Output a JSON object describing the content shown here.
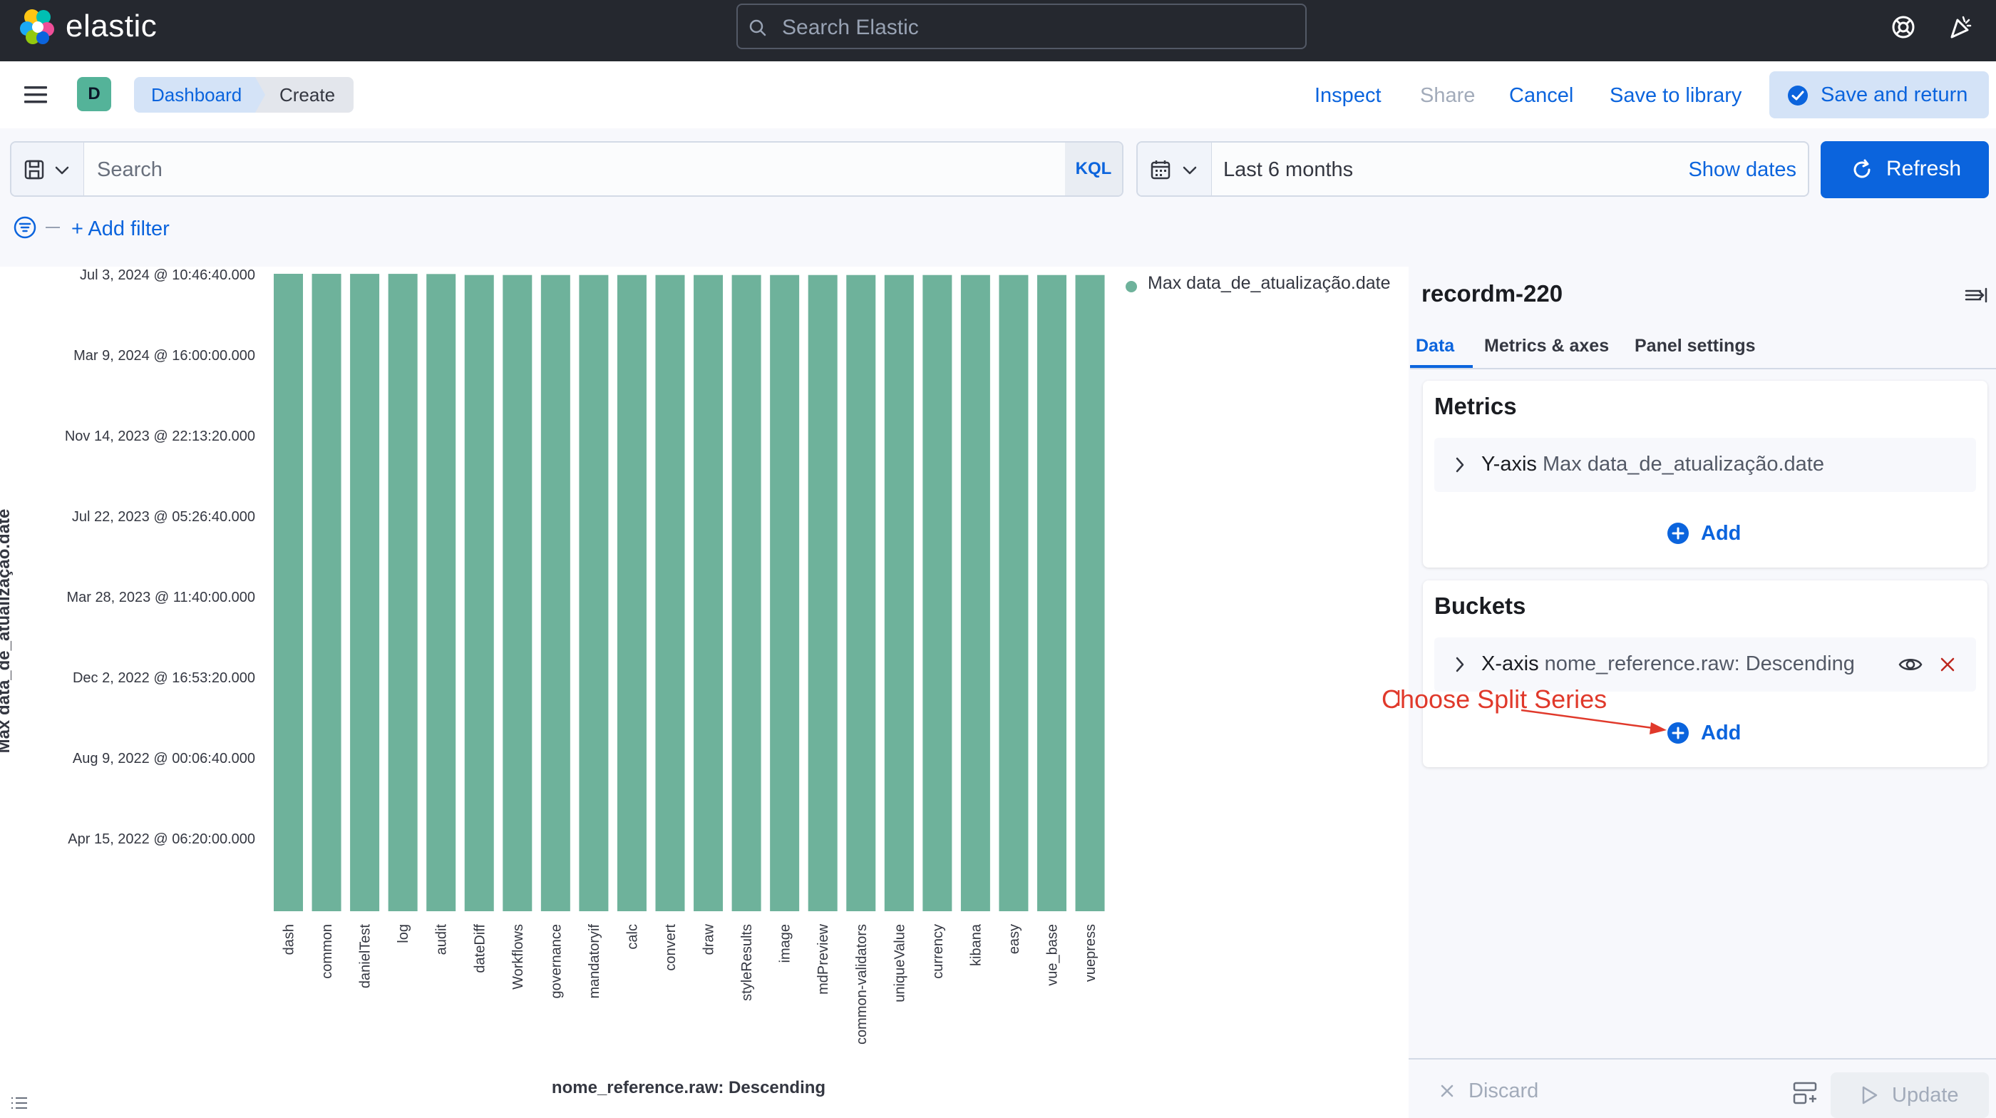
{
  "header": {
    "app_name": "elastic",
    "search_placeholder": "Search Elastic",
    "icons": [
      "elastic-logo",
      "help-icon",
      "newsfeed-icon"
    ]
  },
  "nav": {
    "avatar_letter": "D",
    "breadcrumbs": [
      "Dashboard",
      "Create"
    ],
    "links": {
      "inspect": "Inspect",
      "share": "Share",
      "cancel": "Cancel",
      "save_to_library": "Save to library",
      "save_and_return": "Save and return"
    }
  },
  "query": {
    "search_placeholder": "Search",
    "language": "KQL",
    "time_range": "Last 6 months",
    "show_dates": "Show dates",
    "refresh": "Refresh",
    "add_filter": "+ Add filter"
  },
  "chart_data": {
    "type": "bar",
    "ylabel": "Max data_de_atualização.date",
    "xlabel": "nome_reference.raw: Descending",
    "legend": [
      "Max data_de_atualização.date"
    ],
    "legend_position": "top-right",
    "color": "#6eb29b",
    "y_ticks": [
      "Jul 3, 2024 @ 10:46:40.000",
      "Mar 9, 2024 @ 16:00:00.000",
      "Nov 14, 2023 @ 22:13:20.000",
      "Jul 22, 2023 @ 05:26:40.000",
      "Mar 28, 2023 @ 11:40:00.000",
      "Dec 2, 2022 @ 16:53:20.000",
      "Aug 9, 2022 @ 00:06:40.000",
      "Apr 15, 2022 @ 06:20:00.000"
    ],
    "categories": [
      "dash",
      "common",
      "danielTest",
      "log",
      "audit",
      "dateDiff",
      "Workflows",
      "governance",
      "mandatoryif",
      "calc",
      "convert",
      "draw",
      "styleResults",
      "image",
      "mdPreview",
      "common-validators",
      "uniqueValue",
      "currency",
      "kibana",
      "easy",
      "vue_base",
      "vuepress"
    ],
    "values": [
      "2024-07-03",
      "2024-07-02",
      "2024-07-01",
      "2024-07-01",
      "2024-06-26",
      "2024-05-26",
      "2024-05-26",
      "2024-05-26",
      "2024-05-26",
      "2024-05-26",
      "2024-05-26",
      "2024-05-26",
      "2024-05-26",
      "2024-05-26",
      "2024-05-26",
      "2024-05-26",
      "2024-05-26",
      "2024-05-26",
      "2024-05-26",
      "2024-05-26",
      "2024-05-26",
      "2024-05-26"
    ]
  },
  "editor": {
    "title": "recordm-220",
    "tabs": [
      "Data",
      "Metrics & axes",
      "Panel settings"
    ],
    "metrics": {
      "title": "Metrics",
      "axis_label": "Y-axis",
      "axis_desc": "Max data_de_atualização.date",
      "add": "Add"
    },
    "buckets": {
      "title": "Buckets",
      "axis_label": "X-axis",
      "axis_desc": "nome_reference.raw: Descending",
      "add": "Add"
    },
    "annotation": "Choose Split Series",
    "discard": "Discard",
    "update": "Update",
    "annotation_color": "#e0392b"
  }
}
